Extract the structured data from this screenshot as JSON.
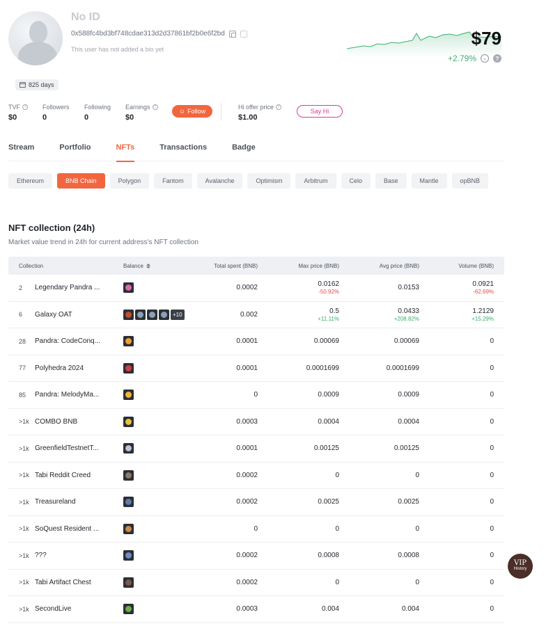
{
  "profile": {
    "name": "No ID",
    "address": "0x588fc4bd3bf748cdae313d2d37861bf2b0e6f2bd",
    "bio": "This user has not added a bio yet",
    "days": "825 days"
  },
  "portfolio": {
    "value": "$79",
    "change": "+2.79%",
    "change_color": "#3cae6e"
  },
  "stats": {
    "tvf_label": "TVF",
    "tvf_value": "$0",
    "followers_label": "Followers",
    "followers_value": "0",
    "following_label": "Following",
    "following_value": "0",
    "earnings_label": "Earnings",
    "earnings_value": "$0",
    "follow_label": "Follow",
    "hi_offer_label": "Hi offer price",
    "hi_offer_value": "$1.00",
    "say_hi_label": "Say Hi"
  },
  "tabs": [
    {
      "label": "Stream"
    },
    {
      "label": "Portfolio"
    },
    {
      "label": "NFTs",
      "active": true
    },
    {
      "label": "Transactions"
    },
    {
      "label": "Badge"
    }
  ],
  "chains": [
    {
      "label": "Ethereum"
    },
    {
      "label": "BNB Chain",
      "active": true
    },
    {
      "label": "Polygon"
    },
    {
      "label": "Fantom"
    },
    {
      "label": "Avalanche"
    },
    {
      "label": "Optimism"
    },
    {
      "label": "Arbitrum"
    },
    {
      "label": "Celo"
    },
    {
      "label": "Base"
    },
    {
      "label": "Mantle"
    },
    {
      "label": "opBNB"
    }
  ],
  "section": {
    "title": "NFT collection (24h)",
    "subtitle": "Market value trend in 24h for current address's NFT collection"
  },
  "table": {
    "headers": {
      "collection": "Collection",
      "balance": "Balance",
      "spent": "Total spent (BNB)",
      "max": "Max price (BNB)",
      "avg": "Avg price (BNB)",
      "volume": "Volume (BNB)"
    },
    "rows": [
      {
        "rank": "2",
        "name": "Legendary Pandra ...",
        "thumbs": [
          "#d66ba8"
        ],
        "spent": "0.0002",
        "max": "0.0162",
        "max_change": "-50.92%",
        "avg": "0.0153",
        "volume": "0.0921",
        "volume_change": "-62.69%"
      },
      {
        "rank": "6",
        "name": "Galaxy OAT",
        "thumbs": [
          "#c0502a",
          "#8aa0b8",
          "#8aa0b8",
          "#8aa0b8"
        ],
        "more": "+10",
        "spent": "0.002",
        "max": "0.5",
        "max_change": "+11.11%",
        "avg": "0.0433",
        "avg_change": "+208.82%",
        "volume": "1.2129",
        "volume_change": "+15.29%"
      },
      {
        "rank": "28",
        "name": "Pandra: CodeConq...",
        "thumbs": [
          "#f0a030"
        ],
        "spent": "0.0001",
        "max": "0.00069",
        "avg": "0.00069",
        "volume": "0"
      },
      {
        "rank": "77",
        "name": "Polyhedra 2024",
        "thumbs": [
          "#d04040"
        ],
        "spent": "0.0001",
        "max": "0.0001699",
        "avg": "0.0001699",
        "volume": "0"
      },
      {
        "rank": "85",
        "name": "Pandra: MelodyMa...",
        "thumbs": [
          "#f2b33a"
        ],
        "spent": "0",
        "max": "0.0009",
        "avg": "0.0009",
        "volume": "0"
      },
      {
        "rank": ">1k",
        "name": "COMBO BNB",
        "thumbs": [
          "#e8c23a"
        ],
        "spent": "0.0003",
        "max": "0.0004",
        "avg": "0.0004",
        "volume": "0"
      },
      {
        "rank": ">1k",
        "name": "GreenfieldTestnetT...",
        "thumbs": [
          "#b9c4d4"
        ],
        "spent": "0.0001",
        "max": "0.00125",
        "avg": "0.00125",
        "volume": "0"
      },
      {
        "rank": ">1k",
        "name": "Tabi Reddit Creed",
        "thumbs": [
          "#8a7a68"
        ],
        "spent": "0.0002",
        "max": "0",
        "avg": "0",
        "volume": "0"
      },
      {
        "rank": ">1k",
        "name": "Treasureland",
        "thumbs": [
          "#5d7ea8"
        ],
        "spent": "0.0002",
        "max": "0.0025",
        "avg": "0.0025",
        "volume": "0"
      },
      {
        "rank": ">1k",
        "name": "SoQuest Resident ...",
        "thumbs": [
          "#c98a4a"
        ],
        "spent": "0",
        "max": "0",
        "avg": "0",
        "volume": "0"
      },
      {
        "rank": ">1k",
        "name": "???",
        "thumbs": [
          "#6a8cc8"
        ],
        "spent": "0.0002",
        "max": "0.0008",
        "avg": "0.0008",
        "volume": "0"
      },
      {
        "rank": ">1k",
        "name": "Tabi Artifact Chest",
        "thumbs": [
          "#7a5a48"
        ],
        "spent": "0.0002",
        "max": "0",
        "avg": "0",
        "volume": "0"
      },
      {
        "rank": ">1k",
        "name": "SecondLive",
        "thumbs": [
          "#6ab048"
        ],
        "spent": "0.0003",
        "max": "0.004",
        "avg": "0.004",
        "volume": "0"
      }
    ]
  },
  "vip": {
    "label": "VIP",
    "sub": "History"
  },
  "colors": {
    "accent": "#f2663f",
    "positive": "#3cae6e",
    "negative": "#e5484d",
    "say_hi": "#e0379a"
  }
}
